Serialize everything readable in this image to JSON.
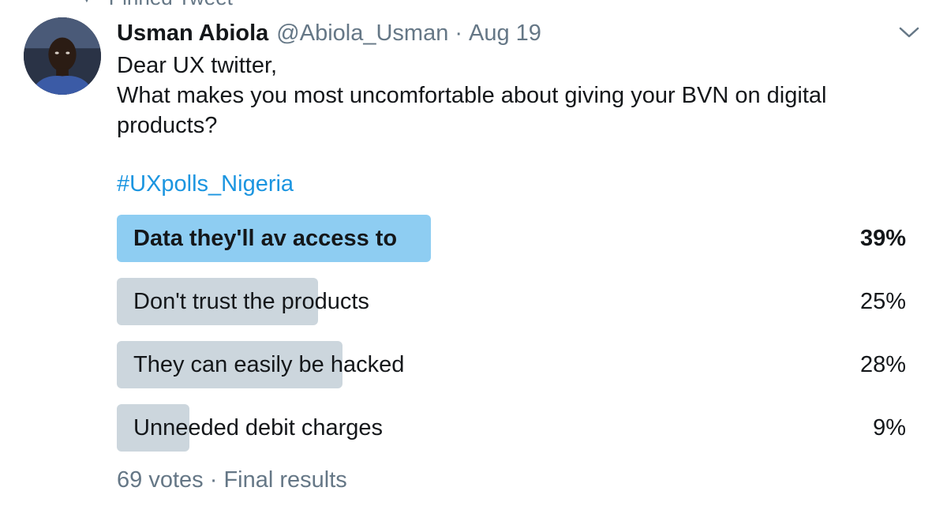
{
  "pinned_label": "Pinned Tweet",
  "author": {
    "display_name": "Usman Abiola",
    "handle": "@Abiola_Usman",
    "separator": "·",
    "date": "Aug 19"
  },
  "tweet": {
    "lines": [
      "Dear UX twitter,",
      "What makes you most uncomfortable about giving your BVN on digital",
      "products?"
    ],
    "hashtag": "#UXpolls_Nigeria"
  },
  "poll": {
    "options": [
      {
        "label": "Data they'll av access to",
        "percent_text": "39%",
        "percent": 39,
        "winner": true
      },
      {
        "label": "Don't trust the products",
        "percent_text": "25%",
        "percent": 25,
        "winner": false
      },
      {
        "label": "They can easily be hacked",
        "percent_text": "28%",
        "percent": 28,
        "winner": false
      },
      {
        "label": "Unneeded debit charges",
        "percent_text": "9%",
        "percent": 9,
        "winner": false
      }
    ],
    "votes": "69 votes",
    "separator": "·",
    "status": "Final results"
  },
  "colors": {
    "winner_bar": "#8ecdf2",
    "bar": "#ccd6dd",
    "hashtag": "#1b95e0",
    "secondary_text": "#657786"
  },
  "icons": {
    "pin": "pin-icon",
    "menu": "chevron-down-icon"
  }
}
